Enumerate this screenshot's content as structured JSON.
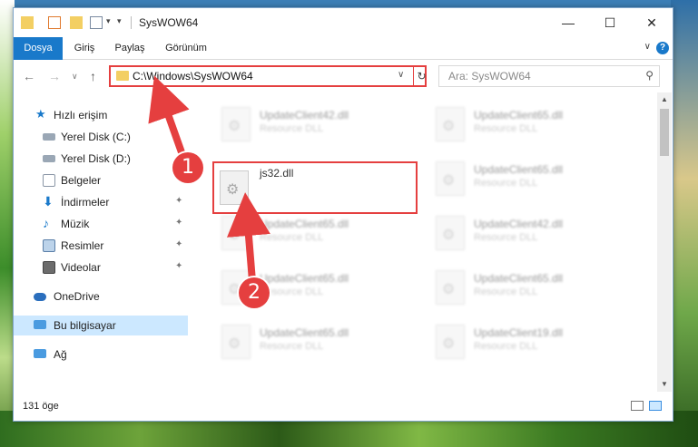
{
  "window": {
    "title": "SysWOW64"
  },
  "ribbon": {
    "tabs": [
      "Dosya",
      "Giriş",
      "Paylaş",
      "Görünüm"
    ],
    "help": "?"
  },
  "address": {
    "path": "C:\\Windows\\SysWOW64",
    "search_placeholder": "Ara: SysWOW64"
  },
  "nav": {
    "quick_access": "Hızlı erişim",
    "items": [
      "Yerel Disk (C:)",
      "Yerel Disk (D:)",
      "Belgeler",
      "İndirmeler",
      "Müzik",
      "Resimler",
      "Videolar"
    ],
    "onedrive": "OneDrive",
    "this_pc": "Bu bilgisayar",
    "network": "Ağ"
  },
  "files": {
    "highlighted": {
      "name": "js32.dll"
    },
    "left_column": [
      {
        "name": "UpdateClient42.dll",
        "desc": "Resource DLL"
      },
      {
        "name": "UpdateClient65.dll",
        "desc": "Resource DLL"
      },
      {
        "name": "UpdateClient65.dll",
        "desc": "Resource DLL"
      },
      {
        "name": "UpdateClient65.dll",
        "desc": "Resource DLL"
      }
    ],
    "right_column": [
      {
        "name": "UpdateClient65.dll",
        "desc": "Resource DLL"
      },
      {
        "name": "UpdateClient65.dll",
        "desc": "Resource DLL"
      },
      {
        "name": "UpdateClient42.dll",
        "desc": "Resource DLL"
      },
      {
        "name": "UpdateClient65.dll",
        "desc": "Resource DLL"
      },
      {
        "name": "UpdateClient19.dll",
        "desc": "Resource DLL"
      }
    ]
  },
  "status": {
    "count": "131 öge"
  },
  "annotations": {
    "step1": "1",
    "step2": "2"
  },
  "colors": {
    "accent": "#1979ca",
    "highlight": "#e53f3f",
    "selection": "#cce8ff"
  }
}
